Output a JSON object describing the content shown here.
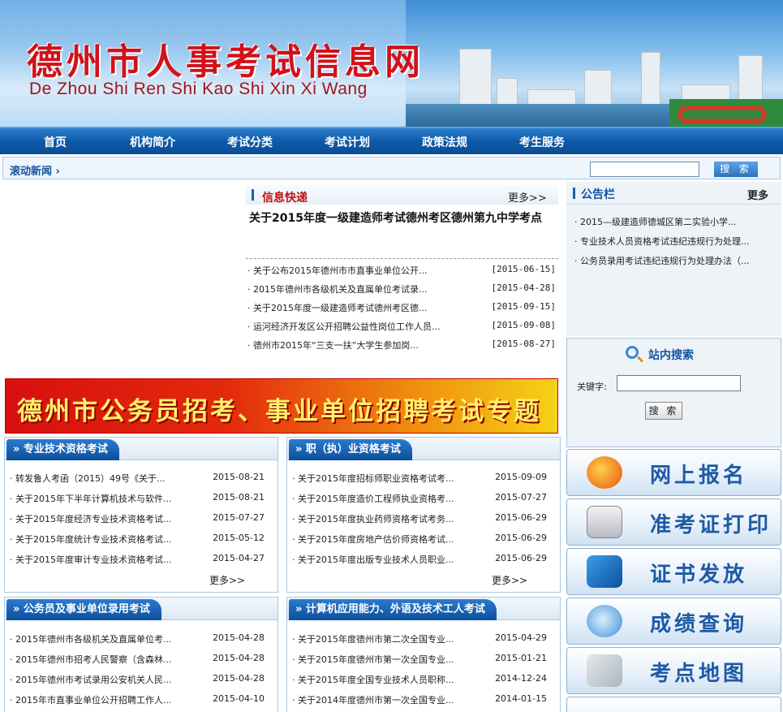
{
  "header": {
    "title": "德州市人事考试信息网",
    "pinyin": "De Zhou Shi Ren Shi Kao Shi Xin Xi Wang"
  },
  "nav": [
    "首页",
    "机构简介",
    "考试分类",
    "考试计划",
    "政策法规",
    "考生服务"
  ],
  "ticker": {
    "label": "滚动新闻 ›",
    "search_button": "搜 索"
  },
  "info_express": {
    "title": "信息快递",
    "more": "更多>>",
    "headline": "关于2015年度一级建造师考试德州考区德州第九中学考点",
    "items": [
      {
        "title": "· 关于公布2015年德州市市直事业单位公开...",
        "date": "[2015-06-15]"
      },
      {
        "title": "· 2015年德州市各级机关及直属单位考试录...",
        "date": "[2015-04-28]"
      },
      {
        "title": "· 关于2015年度一级建造师考试德州考区德...",
        "date": "[2015-09-15]"
      },
      {
        "title": "· 运河经济开发区公开招聘公益性岗位工作人员...",
        "date": "[2015-09-08]"
      },
      {
        "title": "· 德州市2015年“三支一扶”大学生参加岗...",
        "date": "[2015-08-27]"
      }
    ]
  },
  "notice": {
    "title": "公告栏",
    "more": "更多",
    "items": [
      "· 2015—级建造师德城区第二实验小学...",
      "· 专业技术人员资格考试违纪违规行为处理...",
      "· 公务员录用考试违纪违规行为处理办法（..."
    ]
  },
  "site_search": {
    "title": "站内搜索",
    "keyword_label": "关键字:",
    "button": "搜 索"
  },
  "services": [
    "网上报名",
    "准考证打印",
    "证书发放",
    "成绩查询",
    "考点地图"
  ],
  "topic_banner": "德州市公务员招考、事业单位招聘考试专题",
  "boxes": [
    {
      "title": "» 专业技术资格考试",
      "more": "更多>>",
      "items": [
        {
          "title": "· 转发鲁人考函（2015）49号《关于...",
          "date": "2015-08-21"
        },
        {
          "title": "· 关于2015年下半年计算机技术与软件...",
          "date": "2015-08-21"
        },
        {
          "title": "· 关于2015年度经济专业技术资格考试...",
          "date": "2015-07-27"
        },
        {
          "title": "· 关于2015年度统计专业技术资格考试...",
          "date": "2015-05-12"
        },
        {
          "title": "· 关于2015年度审计专业技术资格考试...",
          "date": "2015-04-27"
        }
      ]
    },
    {
      "title": "» 职（执）业资格考试",
      "more": "更多>>",
      "items": [
        {
          "title": "· 关于2015年度招标师职业资格考试考...",
          "date": "2015-09-09"
        },
        {
          "title": "· 关于2015年度造价工程师执业资格考...",
          "date": "2015-07-27"
        },
        {
          "title": "· 关于2015年度执业药师资格考试考务...",
          "date": "2015-06-29"
        },
        {
          "title": "· 关于2015年度房地产估价师资格考试...",
          "date": "2015-06-29"
        },
        {
          "title": "· 关于2015年度出版专业技术人员职业...",
          "date": "2015-06-29"
        }
      ]
    },
    {
      "title": "» 公务员及事业单位录用考试",
      "items": [
        {
          "title": "· 2015年德州市各级机关及直属单位考...",
          "date": "2015-04-28"
        },
        {
          "title": "· 2015年德州市招考人民警察（含森林...",
          "date": "2015-04-28"
        },
        {
          "title": "· 2015年德州市考试录用公安机关人民...",
          "date": "2015-04-28"
        },
        {
          "title": "· 2015年市直事业单位公开招聘工作人...",
          "date": "2015-04-10"
        }
      ]
    },
    {
      "title": "» 计算机应用能力、外语及技术工人考试",
      "items": [
        {
          "title": "· 关于2015年度德州市第二次全国专业...",
          "date": "2015-04-29"
        },
        {
          "title": "· 关于2015年度德州市第一次全国专业...",
          "date": "2015-01-21"
        },
        {
          "title": "· 关于2015年度全国专业技术人员职称...",
          "date": "2014-12-24"
        },
        {
          "title": "· 关于2014年度德州市第一次全国专业...",
          "date": "2014-01-15"
        }
      ]
    }
  ]
}
